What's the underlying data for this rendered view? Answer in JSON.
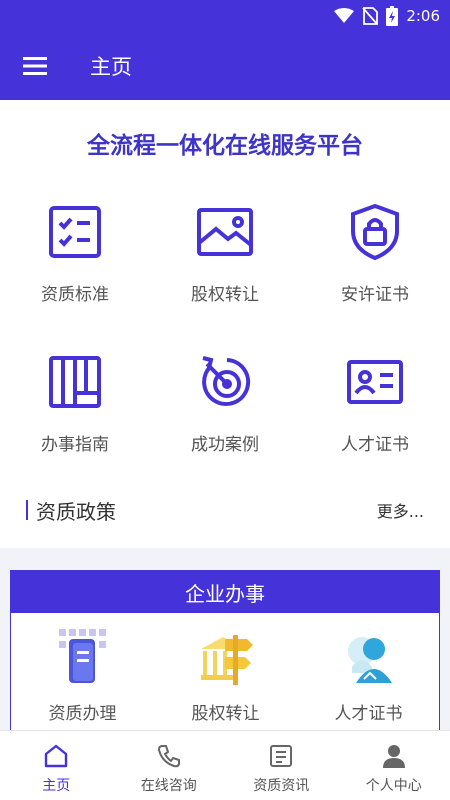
{
  "status_bar": {
    "time": "2:06"
  },
  "header": {
    "title": "主页"
  },
  "slogan": "全流程一体化在线服务平台",
  "services": [
    {
      "label": "资质标准",
      "icon": "checklist-icon"
    },
    {
      "label": "股权转让",
      "icon": "image-icon"
    },
    {
      "label": "安许证书",
      "icon": "shield-lock-icon"
    },
    {
      "label": "办事指南",
      "icon": "book-icon"
    },
    {
      "label": "成功案例",
      "icon": "target-icon"
    },
    {
      "label": "人才证书",
      "icon": "id-card-icon"
    }
  ],
  "policy": {
    "title": "资质政策",
    "more": "更多..."
  },
  "enterprise": {
    "title": "企业办事",
    "items": [
      {
        "label": "资质办理",
        "icon": "document-3d-icon"
      },
      {
        "label": "股权转让",
        "icon": "signpost-3d-icon"
      },
      {
        "label": "人才证书",
        "icon": "person-3d-icon"
      }
    ]
  },
  "tabs": [
    {
      "label": "主页",
      "icon": "home-icon",
      "active": true
    },
    {
      "label": "在线咨询",
      "icon": "phone-icon",
      "active": false
    },
    {
      "label": "资质资讯",
      "icon": "news-icon",
      "active": false
    },
    {
      "label": "个人中心",
      "icon": "user-icon",
      "active": false
    }
  ],
  "colors": {
    "primary": "#4532d8",
    "background": "#f1f3f8"
  }
}
